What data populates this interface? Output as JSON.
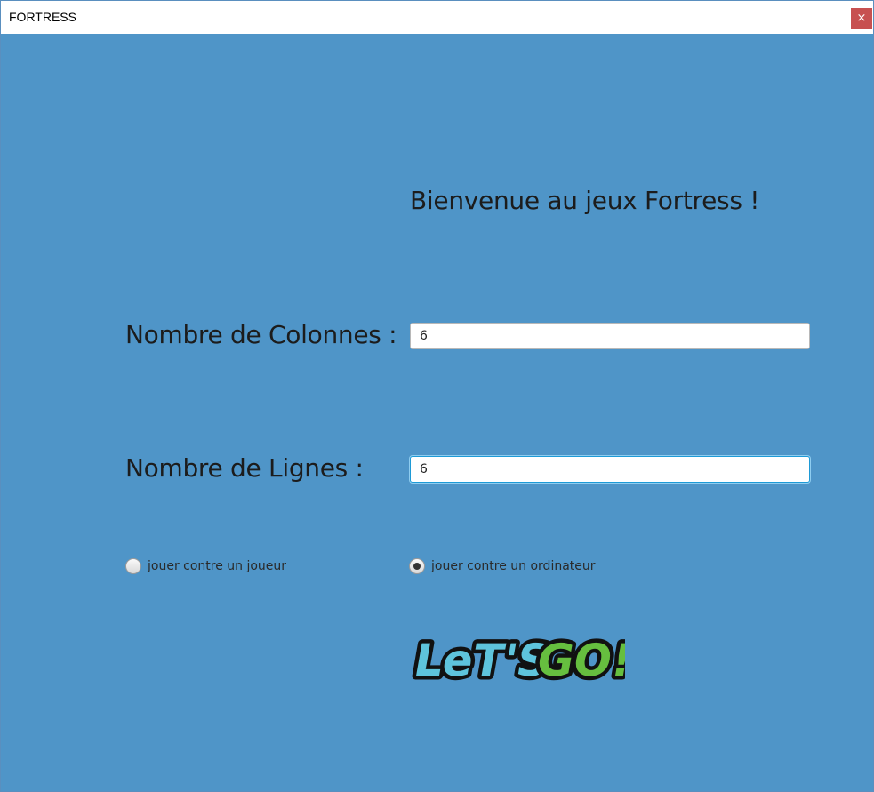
{
  "window": {
    "title": "FORTRESS",
    "close_label": "×"
  },
  "welcome": {
    "text": "Bienvenue au jeux Fortress !"
  },
  "columns": {
    "label": "Nombre de Colonnes :",
    "value": "6"
  },
  "rows": {
    "label": "Nombre de Lignes :",
    "value": "6"
  },
  "mode": {
    "options": [
      {
        "label": "jouer contre un joueur",
        "selected": false
      },
      {
        "label": "jouer contre un ordinateur",
        "selected": true
      }
    ]
  },
  "start_button": {
    "text_part1": "LeT'S",
    "text_part2": "GO!",
    "colors": {
      "part1": "#5ec4dc",
      "part2": "#66bf3f",
      "outline": "#111111"
    }
  },
  "colors": {
    "background": "#4f95c8",
    "close_button": "#c75050",
    "focus_border": "#1e9ad6"
  }
}
